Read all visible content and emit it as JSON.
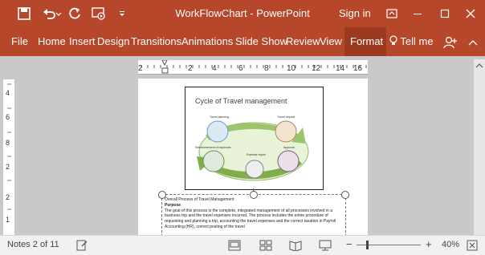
{
  "window": {
    "title": "WorkFlowChart  -  PowerPoint",
    "signin": "Sign in"
  },
  "qat": {
    "save": "save-icon",
    "undo": "undo-icon",
    "redo": "redo-icon",
    "present": "present-icon",
    "customize": "customize-icon"
  },
  "ribbon": {
    "tabs": [
      "File",
      "Home",
      "Insert",
      "Design",
      "Transitions",
      "Animations",
      "Slide Show",
      "Review",
      "View",
      "Format"
    ],
    "tell_me": "Tell me"
  },
  "ruler": {
    "h_labels": [
      "2",
      "1",
      "1",
      "2",
      "1",
      "4",
      "1",
      "6",
      "1",
      "8",
      "1",
      "10",
      "1",
      "12",
      "1",
      "14",
      "1",
      "16"
    ],
    "v_labels": [
      "4",
      "6",
      "8",
      "10",
      "12",
      "14",
      "16",
      "2",
      "1",
      "2"
    ]
  },
  "slide": {
    "title": "Cycle of Travel management",
    "labels": [
      "Travel planning",
      "Travel request",
      "Reimbursement of expenses",
      "Expense report",
      "Approval"
    ]
  },
  "notes": {
    "heading": "Overall Process of Travel Management",
    "purpose": "Purpose",
    "body": "The goal of this process is the complete, integrated management of all processes involved in a business trip and the travel expenses incurred. The process includes the entire procedure of requesting and planning a trip, accounting the travel expenses and the correct taxation in Payroll Accounting (HR), correct posting of the travel"
  },
  "status": {
    "notes_count": "Notes 2 of 11",
    "zoom": "40%"
  },
  "colors": {
    "brand": "#b7472a",
    "format_tab": "#9c3a20"
  }
}
